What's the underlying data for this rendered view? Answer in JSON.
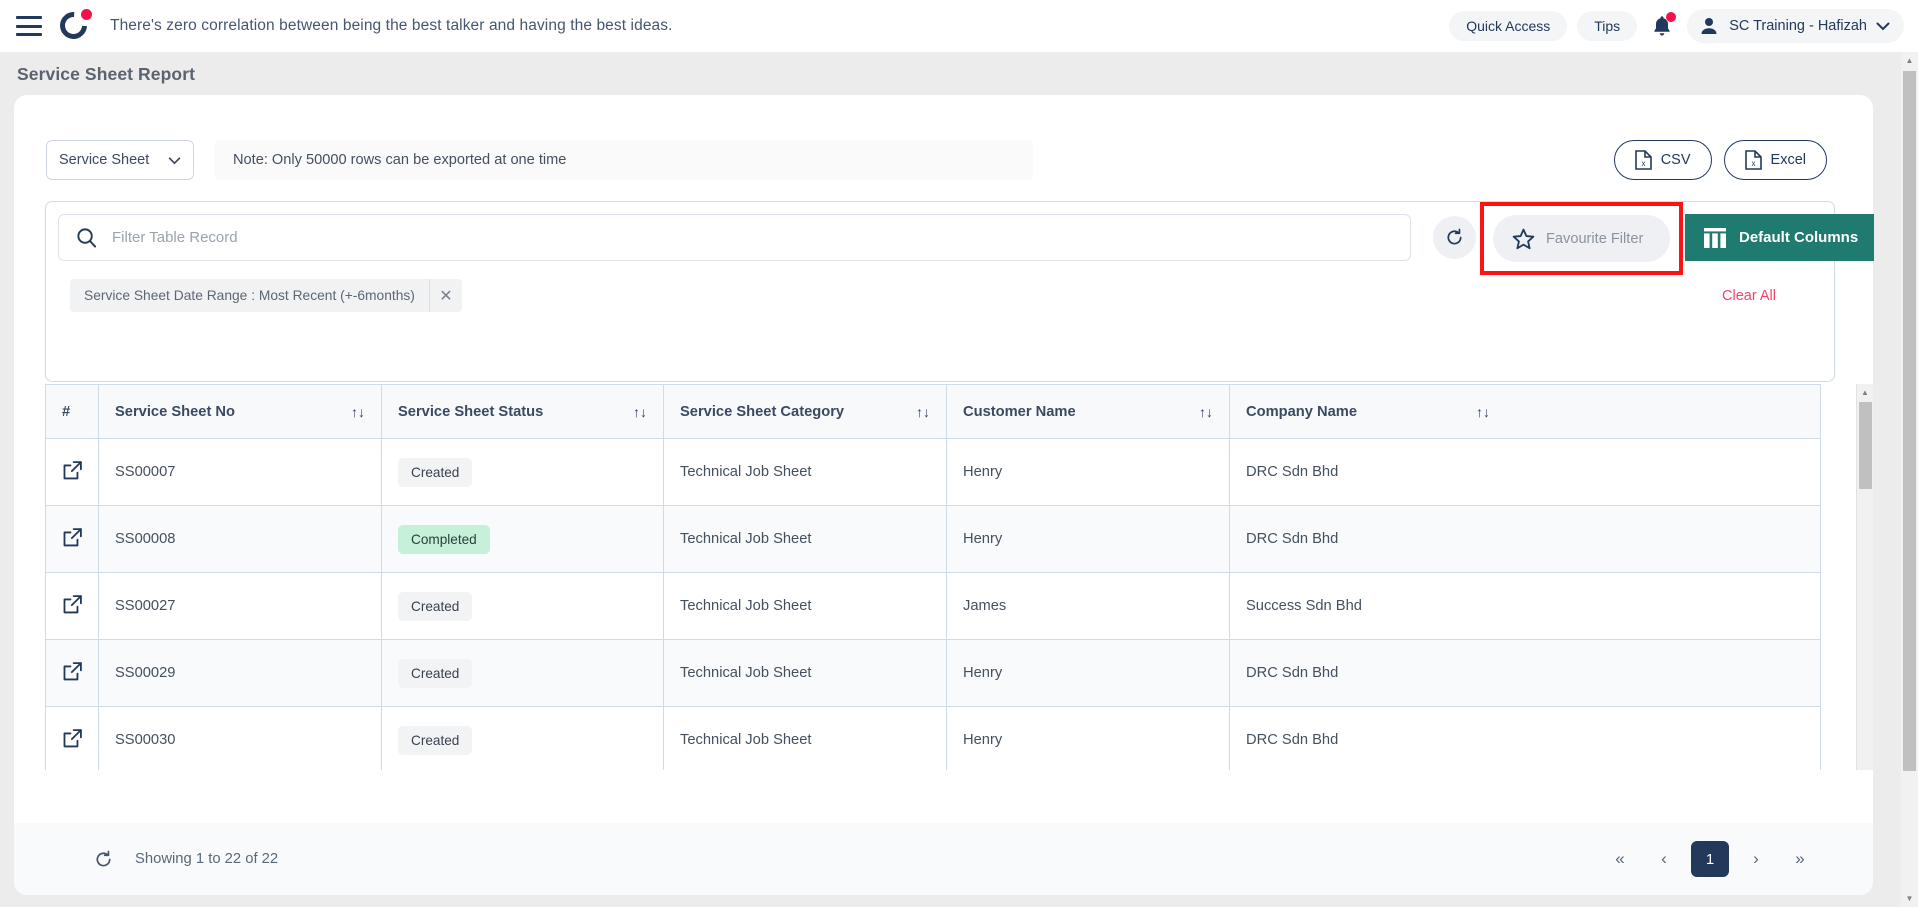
{
  "topnav": {
    "menu_icon": "hamburger-icon",
    "logo_icon": "brand-logo-icon",
    "tagline": "There's zero correlation between being the best talker and having the best ideas.",
    "quick_access": "Quick Access",
    "tips": "Tips",
    "notification_icon": "bell-icon",
    "user_name": "SC Training - Hafizah"
  },
  "page": {
    "title": "Service Sheet Report"
  },
  "export_bar": {
    "sheet_select_value": "Service Sheet",
    "note": "Note: Only 50000 rows can be exported at one time",
    "csv_label": "CSV",
    "excel_label": "Excel"
  },
  "filter": {
    "search_placeholder": "Filter Table Record",
    "search_value": "",
    "refresh_icon": "refresh-icon",
    "favourite_filter_label": "Favourite Filter",
    "default_columns_label": "Default Columns",
    "chip_label": "Service Sheet Date Range : Most Recent (+-6months)",
    "chip_close": "✕",
    "clear_all": "Clear All",
    "highlight_color": "#fb1414",
    "accent_color": "#1f7a70"
  },
  "table": {
    "columns": [
      {
        "label": "#",
        "sortable": false
      },
      {
        "label": "Service Sheet No",
        "sortable": true
      },
      {
        "label": "Service Sheet Status",
        "sortable": true
      },
      {
        "label": "Service Sheet Category",
        "sortable": true
      },
      {
        "label": "Customer Name",
        "sortable": true
      },
      {
        "label": "Company Name",
        "sortable": true
      }
    ],
    "sort_icon": "↑↓",
    "rows": [
      {
        "no": "SS00007",
        "status": "Created",
        "status_kind": "created",
        "category": "Technical Job Sheet",
        "customer": "Henry",
        "company": "DRC Sdn Bhd"
      },
      {
        "no": "SS00008",
        "status": "Completed",
        "status_kind": "completed",
        "category": "Technical Job Sheet",
        "customer": "Henry",
        "company": "DRC Sdn Bhd"
      },
      {
        "no": "SS00027",
        "status": "Created",
        "status_kind": "created",
        "category": "Technical Job Sheet",
        "customer": "James",
        "company": "Success Sdn Bhd"
      },
      {
        "no": "SS00029",
        "status": "Created",
        "status_kind": "created",
        "category": "Technical Job Sheet",
        "customer": "Henry",
        "company": "DRC Sdn Bhd"
      },
      {
        "no": "SS00030",
        "status": "Created",
        "status_kind": "created",
        "category": "Technical Job Sheet",
        "customer": "Henry",
        "company": "DRC Sdn Bhd"
      }
    ]
  },
  "footer": {
    "refresh_icon": "refresh-icon",
    "showing_text": "Showing 1 to 22 of 22",
    "first_page": "«",
    "prev_page": "‹",
    "current_page": "1",
    "next_page": "›",
    "last_page": "»"
  }
}
